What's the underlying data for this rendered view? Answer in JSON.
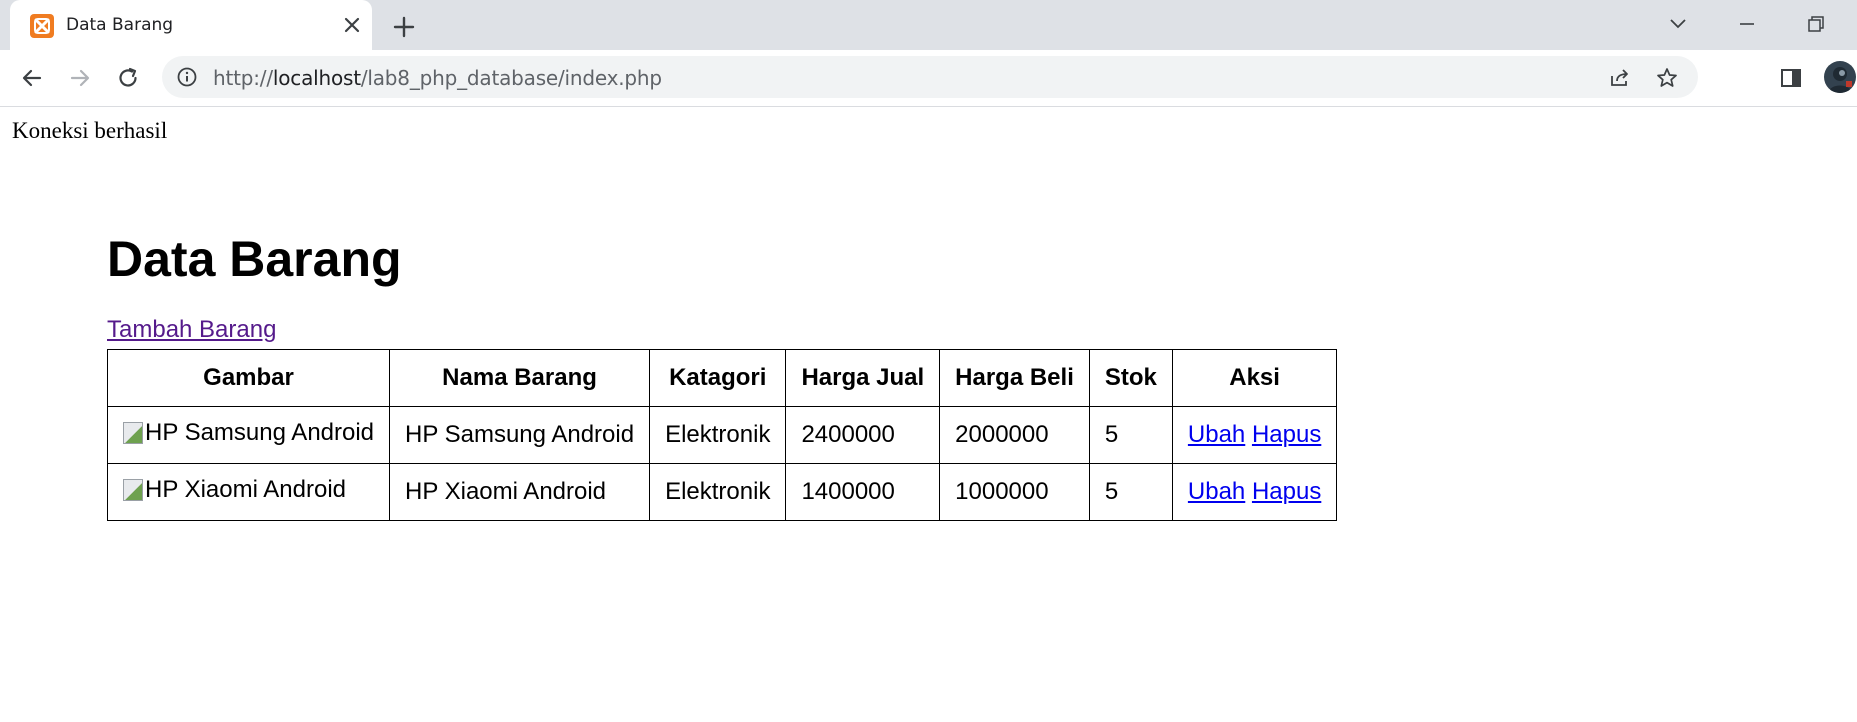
{
  "browser": {
    "tab_title": "Data Barang",
    "url_prefix": "http://",
    "url_host": "localhost",
    "url_path": "/lab8_php_database/index.php"
  },
  "page": {
    "status_text": "Koneksi berhasil",
    "heading": "Data Barang",
    "add_link": "Tambah Barang"
  },
  "table": {
    "headers": [
      "Gambar",
      "Nama Barang",
      "Katagori",
      "Harga Jual",
      "Harga Beli",
      "Stok",
      "Aksi"
    ],
    "rows": [
      {
        "gambar_alt": "HP Samsung Android",
        "nama": "HP Samsung Android",
        "kategori": "Elektronik",
        "harga_jual": "2400000",
        "harga_beli": "2000000",
        "stok": "5",
        "ubah": "Ubah",
        "hapus": "Hapus"
      },
      {
        "gambar_alt": "HP Xiaomi Android",
        "nama": "HP Xiaomi Android",
        "kategori": "Elektronik",
        "harga_jual": "1400000",
        "harga_beli": "1000000",
        "stok": "5",
        "ubah": "Ubah",
        "hapus": "Hapus"
      }
    ]
  },
  "colors": {
    "link_visited": "#551a8b",
    "link": "#0000ee",
    "tabstrip_bg": "#dee1e6",
    "favicon": "#f07c21"
  },
  "icons": [
    "xampp-favicon-icon",
    "close-icon",
    "plus-icon",
    "chevron-down-icon",
    "minimize-icon",
    "restore-icon",
    "back-arrow-icon",
    "forward-arrow-icon",
    "reload-icon",
    "info-icon",
    "share-icon",
    "star-icon",
    "side-panel-icon",
    "avatar",
    "broken-image-icon"
  ]
}
